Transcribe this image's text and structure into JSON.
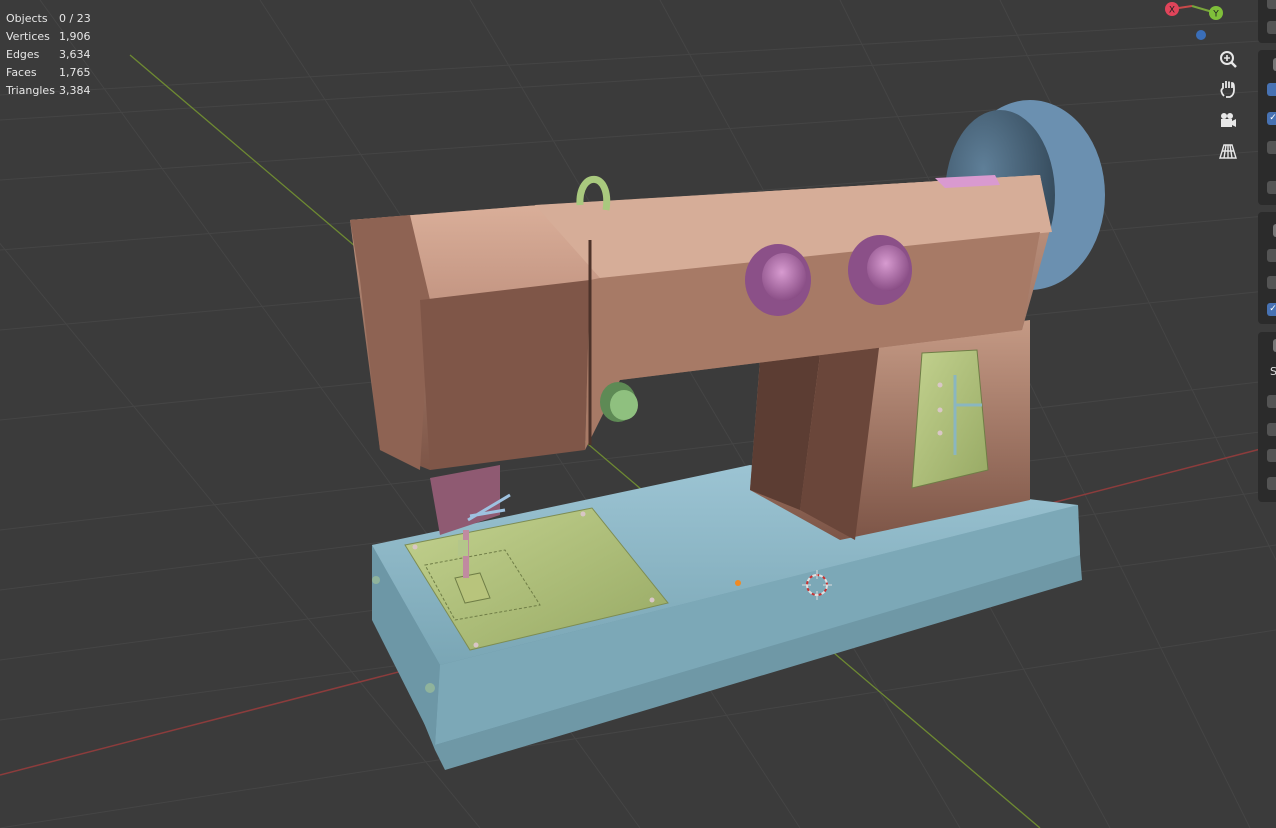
{
  "viewport": {
    "stats": [
      {
        "label": "Objects",
        "value": "0 / 23"
      },
      {
        "label": "Vertices",
        "value": "1,906"
      },
      {
        "label": "Edges",
        "value": "3,634"
      },
      {
        "label": "Faces",
        "value": "1,765"
      },
      {
        "label": "Triangles",
        "value": "3,384"
      }
    ],
    "gizmo": {
      "x_label": "X",
      "y_label": "Y"
    },
    "nav_icons": [
      "zoom-icon",
      "hand-pan-icon",
      "camera-icon",
      "grid-perspective-icon"
    ]
  },
  "side_panel": {
    "partial_label": "Sy"
  },
  "colors": {
    "background": "#3b3b3b",
    "grid": "#444444",
    "x_axis": "#8c3c3c",
    "y_axis": "#6e8a32",
    "machine_body": "#b98772",
    "machine_base": "#8fb8c6",
    "knobs": "#b070a8",
    "plates": "#a8b872",
    "accent": "#4772b3"
  }
}
